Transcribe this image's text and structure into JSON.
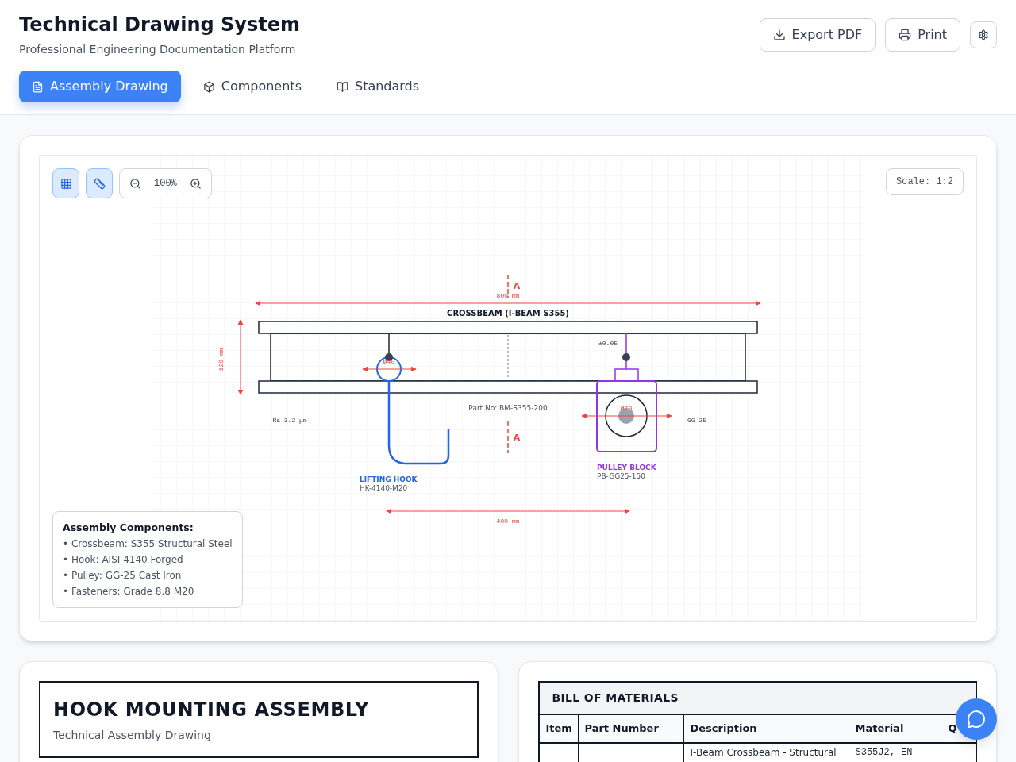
{
  "header": {
    "title": "Technical Drawing System",
    "subtitle": "Professional Engineering Documentation Platform",
    "actions": [
      {
        "label": "Export PDF"
      },
      {
        "label": "Print"
      }
    ]
  },
  "tabs": [
    {
      "label": "Assembly Drawing",
      "selected": true
    },
    {
      "label": "Components",
      "selected": false
    },
    {
      "label": "Standards",
      "selected": false
    }
  ],
  "canvas": {
    "toolbar": {
      "grid_on": true,
      "ruler_on": true,
      "zoom": "100%"
    },
    "scale": "Scale: 1:2",
    "drawing": {
      "section_marks": [
        "A",
        "A"
      ],
      "width_dim": "800 mm",
      "height_dim": "120 mm",
      "beam_label": "CROSSBEAM (I-BEAM S355)",
      "hook_dia": "Ø40",
      "tolerance": "±0.05",
      "part_no": "Part No: BM-S355-200",
      "roughness": "Ra 3.2 μm",
      "pulley_dia": "Ø70",
      "pulley_material": "GG-25",
      "hook_name": "LIFTING HOOK",
      "hook_code": "HK-4140-M20",
      "pulley_name": "PULLEY BLOCK",
      "pulley_code": "PB-GG25-150",
      "spacing_dim": "400 mm"
    },
    "legend": {
      "title": "Assembly Components:",
      "items": [
        "• Crossbeam: S355 Structural Steel",
        "• Hook: AISI 4140 Forged",
        "• Pulley: GG-25 Cast Iron",
        "• Fasteners: Grade 8.8 M20"
      ]
    }
  },
  "title_block": {
    "title": "HOOK MOUNTING ASSEMBLY",
    "subtitle": "Technical Assembly Drawing"
  },
  "bom": {
    "title": "BILL OF MATERIALS",
    "columns": [
      "Item",
      "Part Number",
      "Description",
      "Material",
      "Q"
    ],
    "rows": [
      {
        "description": "I-Beam Crossbeam - Structural",
        "material": "S355J2, EN"
      }
    ]
  }
}
